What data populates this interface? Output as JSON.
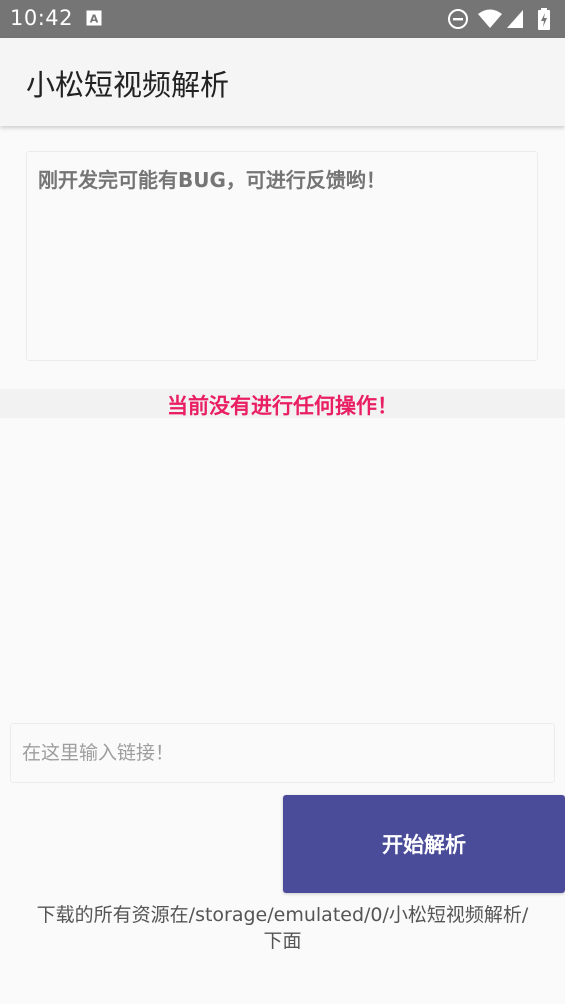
{
  "status_bar": {
    "time": "10:42",
    "icons": [
      "text-notification-icon",
      "do-not-disturb-icon",
      "wifi-icon",
      "cell-signal-icon",
      "battery-charging-icon"
    ]
  },
  "app_bar": {
    "title": "小松短视频解析"
  },
  "notice": {
    "text": "刚开发完可能有BUG，可进行反馈哟！"
  },
  "status": {
    "text": "当前没有进行任何操作！",
    "color": "#e91e63"
  },
  "link_input": {
    "placeholder": "在这里输入链接！",
    "value": ""
  },
  "start_button": {
    "label": "开始解析",
    "color": "#4a4c9a"
  },
  "footer": {
    "line1": "下载的所有资源在/storage/emulated/0/小松短视频解析/",
    "line2": "下面"
  }
}
